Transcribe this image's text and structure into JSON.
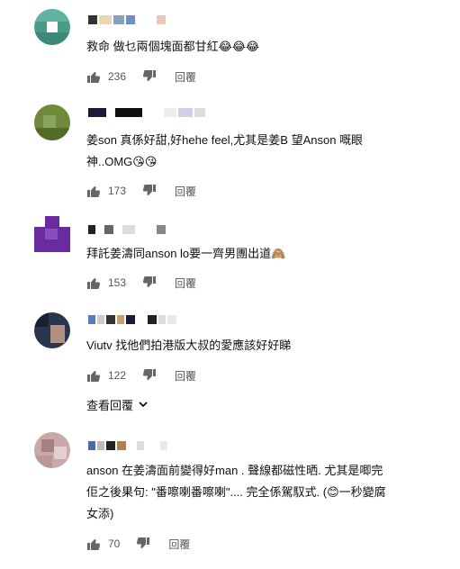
{
  "comments": [
    {
      "text": "救命 做乜兩個塊面都甘紅😂😂😂",
      "likes": "236",
      "reply_label": "回覆",
      "avatar_color": "#4a9b8a"
    },
    {
      "text": "姜son 真係好甜,好hehe feel,尤其是姜B 望Anson 嘅眼神..OMG😘😘",
      "likes": "173",
      "reply_label": "回覆",
      "avatar_color": "#6f8a3a"
    },
    {
      "text": "拜託姜濤同anson lo要一齊男團出道🙈",
      "likes": "153",
      "reply_label": "回覆",
      "avatar_color": "#6a2aa0"
    },
    {
      "text": "Viutv 找他們拍港版大叔的愛應該好好睇",
      "likes": "122",
      "reply_label": "回覆",
      "avatar_color": "#2a3550"
    },
    {
      "text": "anson 在姜濤面前變得好man . 聲線都磁性晒. 尤其是唧完佢之後果句: \"番嚓喇番嚓喇\".... 完全係駕馭式. (😊一秒變腐女添)",
      "likes": "70",
      "reply_label": "回覆",
      "avatar_color": "#c8a8a8"
    }
  ],
  "view_replies_label": "查看回覆"
}
